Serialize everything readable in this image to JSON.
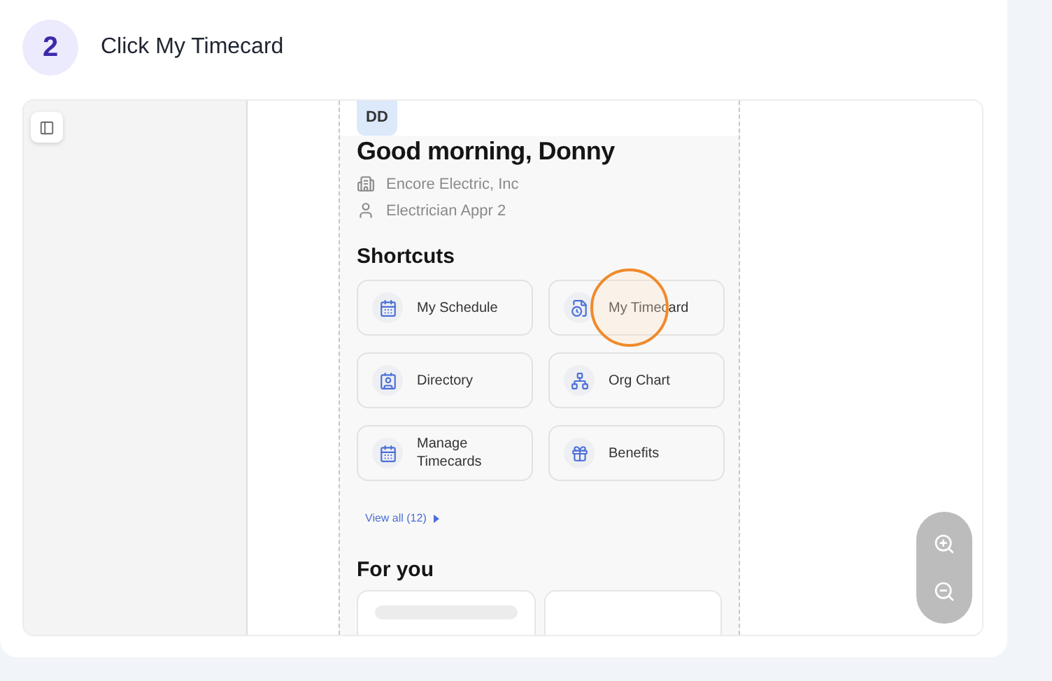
{
  "step": {
    "number": "2",
    "title": "Click My Timecard"
  },
  "app": {
    "avatar": "DD",
    "greeting": "Good morning, Donny",
    "company": "Encore Electric, Inc",
    "role": "Electrician Appr 2",
    "shortcuts_title": "Shortcuts",
    "shortcuts": [
      {
        "label": "My Schedule",
        "highlighted": false
      },
      {
        "label": "My Timecard",
        "highlighted": true
      },
      {
        "label": "Directory",
        "highlighted": false
      },
      {
        "label": "Org Chart",
        "highlighted": false
      },
      {
        "label": "Manage Timecards",
        "highlighted": false
      },
      {
        "label": "Benefits",
        "highlighted": false
      }
    ],
    "view_all": "View all (12)",
    "for_you_title": "For you"
  }
}
